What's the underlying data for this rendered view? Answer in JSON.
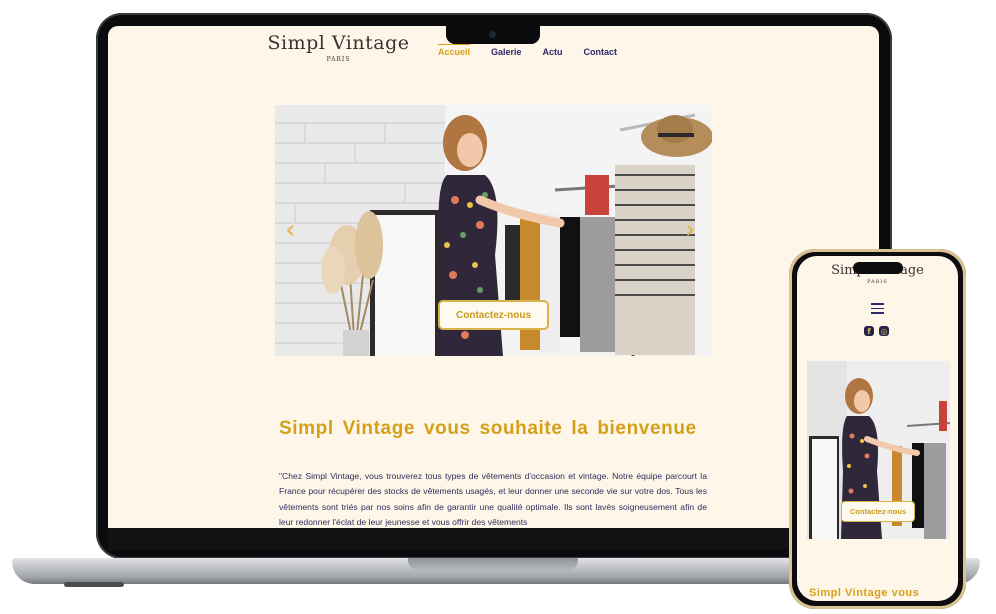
{
  "site": {
    "brand_name": "Simpl Vintage",
    "brand_sub": "PARIS",
    "nav": [
      "Accueil",
      "Galerie",
      "Actu",
      "Contact"
    ],
    "active_nav": "Accueil",
    "hero_cta": "Contactez-nous",
    "prev_glyph": "‹",
    "next_glyph": "›",
    "welcome_title": "Simpl Vintage vous souhaite la bienvenue",
    "intro_text": "\"Chez Simpl Vintage, vous trouverez tous types de vêtements d'occasion et vintage. Notre équipe parcourt la France pour récupérer des stocks de vêtements usagés, et leur donner une seconde vie sur votre dos. Tous les vêtements sont triés par nos soins afin de garantir une qualité optimale. Ils sont lavés soigneusement afin de leur redonner l'éclat de leur jeunesse et vous offrir des vêtements"
  },
  "mobile": {
    "brand_name": "Simpl Vintage",
    "brand_sub": "PARIS",
    "menu_icon": "hamburger-icon",
    "social_icons": [
      "facebook-icon",
      "instagram-icon"
    ],
    "facebook_glyph": "f",
    "instagram_glyph": "◎",
    "hero_cta": "Contactez-nous",
    "welcome_partial": "Simpl Vintage vous"
  },
  "colors": {
    "accent_gold": "#d4a01a",
    "nav_navy": "#2a2a6a",
    "background_cream": "#fff6ea"
  }
}
